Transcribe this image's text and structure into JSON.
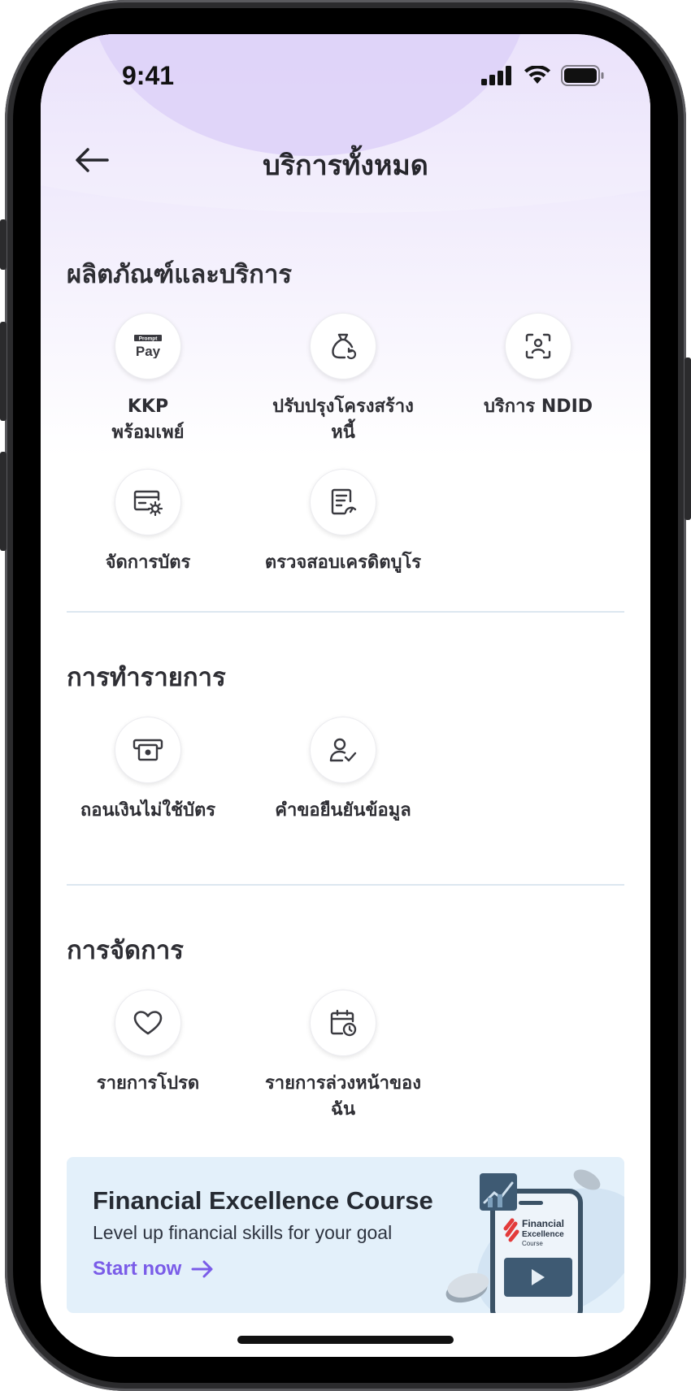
{
  "status_bar": {
    "time": "9:41"
  },
  "header": {
    "title": "บริการทั้งหมด"
  },
  "sections": [
    {
      "title": "ผลิตภัณฑ์และบริการ",
      "items": [
        {
          "label": "KKP",
          "label2": "พร้อมเพย์",
          "icon": "promptpay-icon"
        },
        {
          "label": "ปรับปรุงโครงสร้าง",
          "label2": "หนี้",
          "icon": "money-bag-icon"
        },
        {
          "label": "บริการ NDID",
          "label2": "",
          "icon": "face-scan-icon"
        },
        {
          "label": "จัดการบัตร",
          "label2": "",
          "icon": "card-settings-icon"
        },
        {
          "label": "ตรวจสอบเครดิตบูโร",
          "label2": "",
          "icon": "credit-report-icon"
        }
      ]
    },
    {
      "title": "การทำรายการ",
      "items": [
        {
          "label": "ถอนเงินไม่ใช้บัตร",
          "label2": "",
          "icon": "cash-withdraw-icon"
        },
        {
          "label": "คำขอยืนยันข้อมูล",
          "label2": "",
          "icon": "user-check-icon"
        }
      ]
    },
    {
      "title": "การจัดการ",
      "items": [
        {
          "label": "รายการโปรด",
          "label2": "",
          "icon": "heart-icon"
        },
        {
          "label": "รายการล่วงหน้าของ",
          "label2": "ฉัน",
          "icon": "calendar-clock-icon"
        }
      ]
    }
  ],
  "banner": {
    "title": "Financial Excellence Course",
    "subtitle": "Level up financial skills for your goal",
    "cta": "Start now",
    "art_text": [
      "Financial",
      "Excellence",
      "Course"
    ]
  },
  "colors": {
    "accent": "#7a5ce8",
    "text": "#2e2e34",
    "banner_bg": "#e3f0fa"
  }
}
